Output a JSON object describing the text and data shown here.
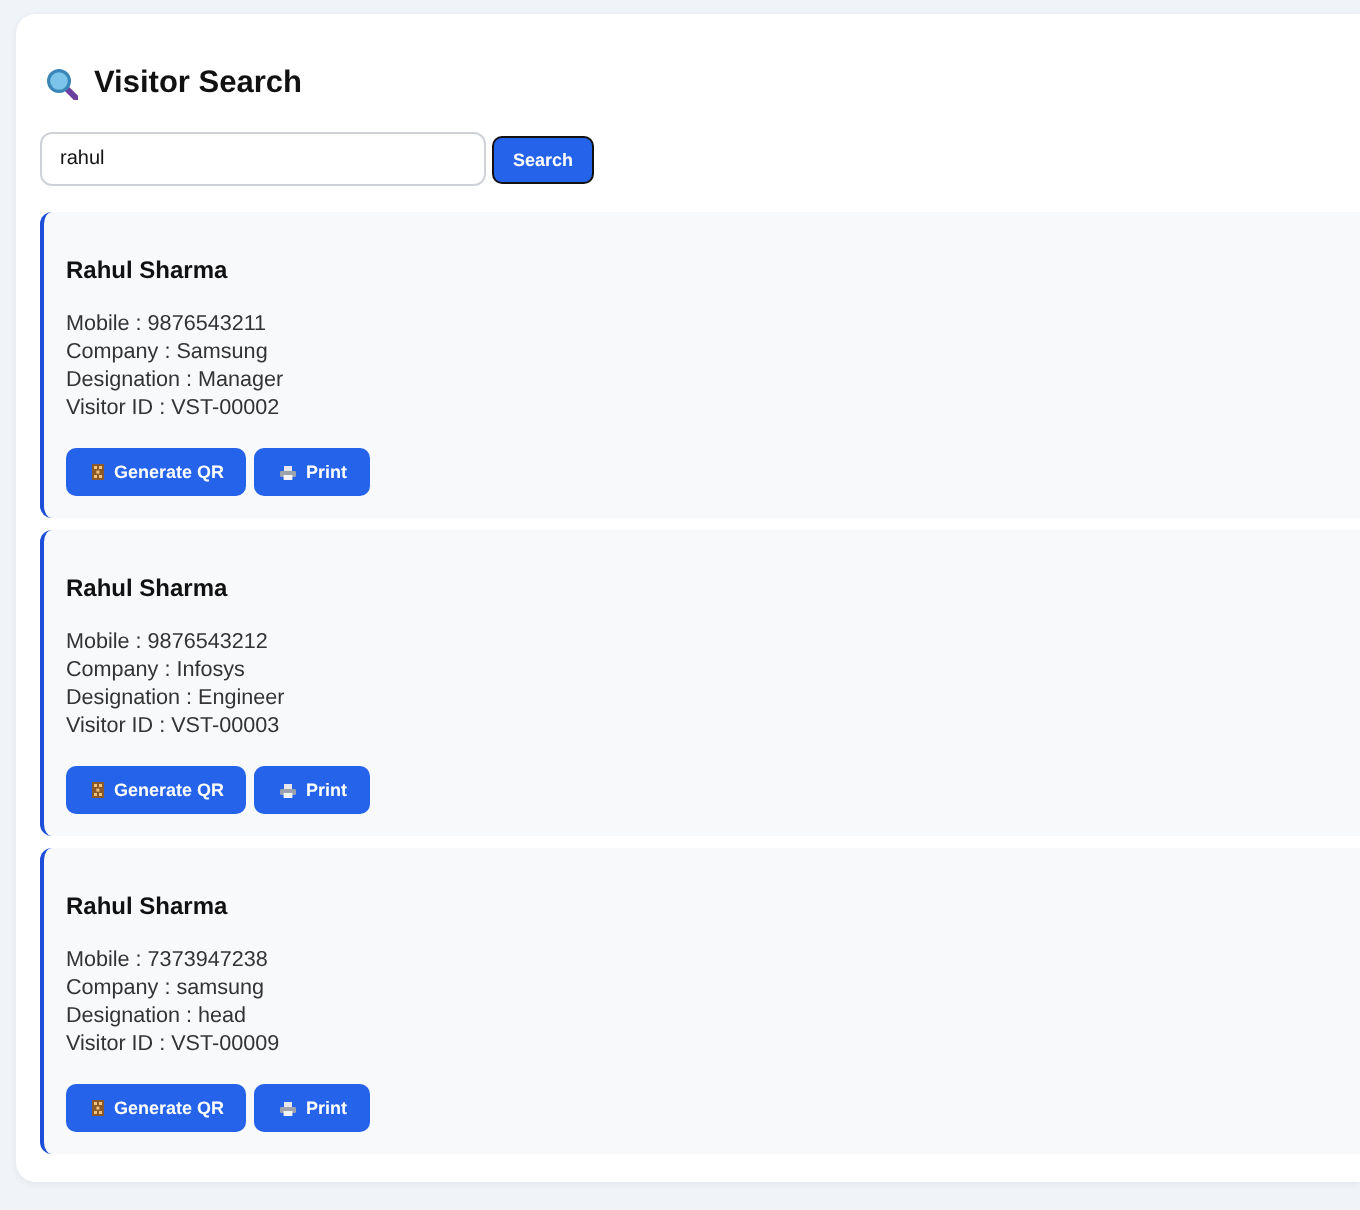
{
  "header": {
    "title": "Visitor Search"
  },
  "search": {
    "value": "rahul",
    "button": {
      "label": "Search",
      "focused": true
    }
  },
  "results": [
    {
      "name": "Rahul Sharma",
      "details": [
        "Mobile : 9876543211",
        "Company : Samsung",
        "Designation : Manager",
        "Visitor ID : VST-00002"
      ],
      "actions": [
        {
          "kind": "qr",
          "label": "Generate QR"
        },
        {
          "kind": "print",
          "label": "Print"
        }
      ]
    },
    {
      "name": "Rahul Sharma",
      "details": [
        "Mobile : 9876543212",
        "Company : Infosys",
        "Designation : Engineer",
        "Visitor ID : VST-00003"
      ],
      "actions": [
        {
          "kind": "qr",
          "label": "Generate QR"
        },
        {
          "kind": "print",
          "label": "Print"
        }
      ]
    },
    {
      "name": "Rahul Sharma",
      "details": [
        "Mobile : 7373947238",
        "Company : samsung",
        "Designation : head",
        "Visitor ID : VST-00009"
      ],
      "actions": [
        {
          "kind": "qr",
          "label": "Generate QR"
        },
        {
          "kind": "print",
          "label": "Print"
        }
      ]
    }
  ]
}
